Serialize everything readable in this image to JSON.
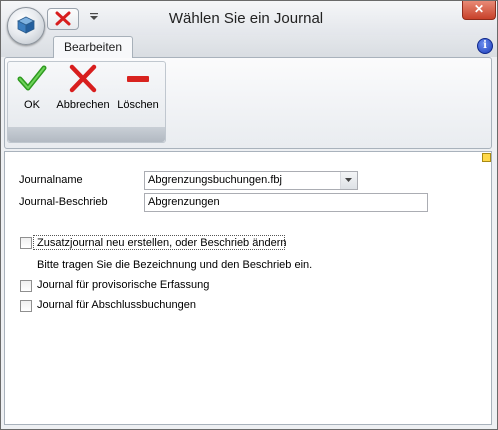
{
  "window": {
    "title": "Wählen Sie ein Journal",
    "close_label": "✕"
  },
  "tabs": [
    {
      "label": "Bearbeiten"
    }
  ],
  "ribbon": {
    "buttons": [
      {
        "label": "OK",
        "icon": "checkmark-icon"
      },
      {
        "label": "Abbrechen",
        "icon": "red-x-icon"
      },
      {
        "label": "Löschen",
        "icon": "red-minus-icon"
      }
    ]
  },
  "form": {
    "journalname_label": "Journalname",
    "journalname_value": "Abgrenzungsbuchungen.fbj",
    "beschrieb_label": "Journal-Beschrieb",
    "beschrieb_value": "Abgrenzungen",
    "check_zusatz_label": "Zusatzjournal neu erstellen, oder Beschrieb ändern",
    "hint_text": "Bitte tragen Sie die Bezeichnung und den Beschrieb ein.",
    "check_provisorisch_label": "Journal für provisorische Erfassung",
    "check_abschluss_label": "Journal für Abschlussbuchungen"
  },
  "colors": {
    "ok_green": "#2e9a1f",
    "cancel_red": "#d81e1e",
    "delete_red": "#d8231f",
    "info_blue": "#1c3cb8"
  }
}
